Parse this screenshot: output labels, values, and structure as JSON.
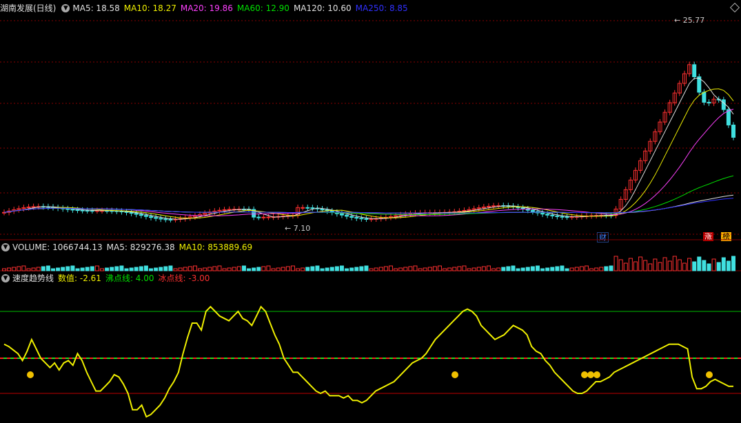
{
  "main": {
    "title": "湖南发展(日线)",
    "ma": [
      {
        "label": "MA5: 18.58",
        "color": "#e0e0e0"
      },
      {
        "label": "MA10: 18.27",
        "color": "#f0f000"
      },
      {
        "label": "MA20: 19.86",
        "color": "#ff40ff"
      },
      {
        "label": "MA60: 12.90",
        "color": "#00e000"
      },
      {
        "label": "MA120: 10.60",
        "color": "#e0e0e0"
      },
      {
        "label": "MA250: 8.85",
        "color": "#3030ff"
      }
    ],
    "high_label": "25.77",
    "low_label": "7.10",
    "badges": {
      "cai": "财",
      "zhang": "涨",
      "bang": "榜"
    }
  },
  "volume": {
    "labels": [
      {
        "label": "VOLUME: 1066744.13",
        "color": "#e0e0e0"
      },
      {
        "label": "MA5: 829276.38",
        "color": "#e0e0e0"
      },
      {
        "label": "MA10: 853889.69",
        "color": "#f0f000"
      }
    ]
  },
  "indicator": {
    "title": "速度趋势线",
    "labels": [
      {
        "label": "数值: -2.61",
        "color": "#f0f000"
      },
      {
        "label": "沸点线: 4.00",
        "color": "#00e000"
      },
      {
        "label": "冰点线: -3.00",
        "color": "#ff3030"
      }
    ]
  },
  "colors": {
    "up": "#ff3030",
    "down": "#40e0e0",
    "grid": "#8b0000"
  },
  "chart_data": {
    "type": "line",
    "series": [
      {
        "name": "数值",
        "values": [
          6,
          5,
          3.5,
          2,
          -1,
          3,
          8,
          4,
          0,
          -2,
          -4,
          -2,
          -5,
          -2,
          -1,
          -3,
          2,
          -1,
          -6,
          -10,
          -14,
          -14,
          -12,
          -10,
          -7,
          -8,
          -11,
          -15,
          -22,
          -22,
          -20,
          -25,
          -24,
          -22,
          -20,
          -17,
          -13,
          -10,
          -6,
          2,
          9,
          15,
          15,
          12,
          20,
          22,
          20,
          18,
          17,
          16,
          18,
          20,
          17,
          16,
          14,
          18,
          22,
          20,
          15,
          10,
          6,
          0,
          -3,
          -6,
          -6,
          -8,
          -10,
          -12,
          -14,
          -15,
          -14,
          -16,
          -16,
          -16,
          -17,
          -16,
          -18,
          -18,
          -19,
          -18,
          -16,
          -14,
          -13,
          -12,
          -11,
          -10,
          -8,
          -6,
          -4,
          -2,
          -1,
          0,
          2,
          5,
          8,
          10,
          12,
          14,
          16,
          18,
          20,
          21,
          20,
          18,
          14,
          12,
          10,
          8,
          9,
          10,
          12,
          14,
          13,
          12,
          10,
          5,
          3,
          2,
          -1,
          -3,
          -6,
          -8,
          -10,
          -12,
          -14,
          -15,
          -15,
          -14,
          -12,
          -10,
          -10,
          -9,
          -8,
          -6,
          -5,
          -4,
          -3,
          -2,
          -1,
          0,
          1,
          2,
          3,
          4,
          5,
          6,
          6,
          6,
          5,
          4,
          -8,
          -13,
          -13,
          -12,
          -10,
          -9,
          -10,
          -11,
          -12,
          -12
        ]
      },
      {
        "name": "沸点线",
        "values": [
          4.0
        ]
      },
      {
        "name": "冰点线",
        "values": [
          -3.0
        ]
      }
    ]
  }
}
